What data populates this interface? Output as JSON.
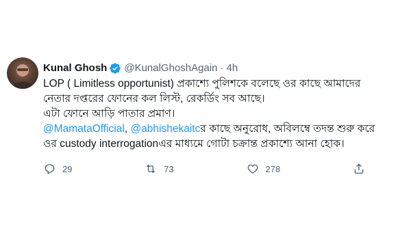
{
  "tweet": {
    "author_name": "Kunal Ghosh",
    "handle": "@KunalGhoshAgain",
    "separator": "·",
    "time": "4h",
    "text_line1": "LOP ( Limitless opportunist) প্রকাশ্যে পুলিশকে বলেছে ওর কাছে আমাদের",
    "text_line2": "নেতার দপ্তরের ফোনের কল লিস্ট, রেকর্ডিং সব আছে।",
    "text_line3": "এটা ফোনে আড়ি পাতার প্রমাণ।",
    "mention1": "@MamataOfficial",
    "comma": ", ",
    "mention2": "@abhishekaitc",
    "text_line4_rest": "র কাছে অনুরোধ, অবিলম্বে তদন্ত শুরু করে",
    "text_line5": "ওর custody interrogationএর মাধ্যমে গোটা চক্রান্ত প্রকাশ্যে আনা হোক।",
    "reply_count": "29",
    "retweet_count": "73",
    "like_count": "278",
    "more_label": "···"
  },
  "colors": {
    "accent": "#1d9bf0",
    "text": "#0f1419",
    "muted": "#536471"
  },
  "icons": {
    "verified": "verified-badge-icon",
    "reply": "reply-icon",
    "retweet": "retweet-icon",
    "like": "heart-icon",
    "share": "share-icon",
    "more": "more-icon"
  }
}
